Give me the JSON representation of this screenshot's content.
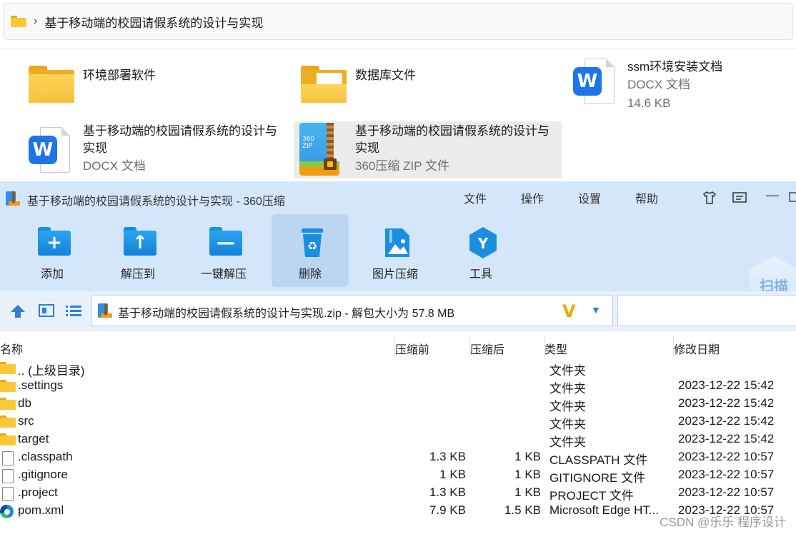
{
  "breadcrumb": {
    "path": "基于移动端的校园请假系统的设计与实现"
  },
  "explorer_items": [
    {
      "name": "环境部署软件",
      "sub1": "",
      "sub2": ""
    },
    {
      "name": "数据库文件",
      "sub1": "",
      "sub2": ""
    },
    {
      "name": "ssm环境安装文档",
      "sub1": "DOCX 文档",
      "sub2": "14.6 KB"
    },
    {
      "name": "基于移动端的校园请假系统的设计与实现",
      "sub1": "DOCX 文档",
      "sub2": ""
    },
    {
      "name": "基于移动端的校园请假系统的设计与实现",
      "sub1": "360压缩 ZIP 文件",
      "sub2": ""
    }
  ],
  "zip_icon_label": "360\nZIP",
  "window": {
    "title": "基于移动端的校园请假系统的设计与实现 - 360压缩",
    "menu": [
      "文件",
      "操作",
      "设置",
      "帮助"
    ],
    "minimize": "—"
  },
  "toolbar": [
    {
      "label": "添加",
      "icon": "add-folder-icon",
      "glyph": "+"
    },
    {
      "label": "解压到",
      "icon": "extract-folder-icon",
      "glyph": "↑"
    },
    {
      "label": "一键解压",
      "icon": "one-click-extract-icon",
      "glyph": "—"
    },
    {
      "label": "删除",
      "icon": "recycle-bin-icon",
      "glyph": "♻"
    },
    {
      "label": "图片压缩",
      "icon": "image-compress-icon",
      "glyph": "▲"
    },
    {
      "label": "工具",
      "icon": "tools-icon",
      "glyph": "Y"
    }
  ],
  "scan_label": "扫描",
  "address": {
    "text": "基于移动端的校园请假系统的设计与实现.zip - 解包大小为 57.8 MB",
    "badge": "V"
  },
  "columns": [
    "名称",
    "压缩前",
    "压缩后",
    "类型",
    "修改日期"
  ],
  "files": [
    {
      "icon": "folder",
      "name": ".. (上级目录)",
      "pre": "",
      "post": "",
      "type": "文件夹",
      "date": ""
    },
    {
      "icon": "folder",
      "name": ".settings",
      "pre": "",
      "post": "",
      "type": "文件夹",
      "date": "2023-12-22 15:42"
    },
    {
      "icon": "folder",
      "name": "db",
      "pre": "",
      "post": "",
      "type": "文件夹",
      "date": "2023-12-22 15:42"
    },
    {
      "icon": "folder",
      "name": "src",
      "pre": "",
      "post": "",
      "type": "文件夹",
      "date": "2023-12-22 15:42"
    },
    {
      "icon": "folder",
      "name": "target",
      "pre": "",
      "post": "",
      "type": "文件夹",
      "date": "2023-12-22 15:42"
    },
    {
      "icon": "file",
      "name": ".classpath",
      "pre": "1.3 KB",
      "post": "1 KB",
      "type": "CLASSPATH 文件",
      "date": "2023-12-22 10:57"
    },
    {
      "icon": "file",
      "name": ".gitignore",
      "pre": "1 KB",
      "post": "1 KB",
      "type": "GITIGNORE 文件",
      "date": "2023-12-22 10:57"
    },
    {
      "icon": "file",
      "name": ".project",
      "pre": "1.3 KB",
      "post": "1 KB",
      "type": "PROJECT 文件",
      "date": "2023-12-22 10:57"
    },
    {
      "icon": "edge",
      "name": "pom.xml",
      "pre": "7.9 KB",
      "post": "1.5 KB",
      "type": "Microsoft Edge HT...",
      "date": "2023-12-22 10:57"
    }
  ],
  "watermark": "CSDN @乐乐 程序设计"
}
